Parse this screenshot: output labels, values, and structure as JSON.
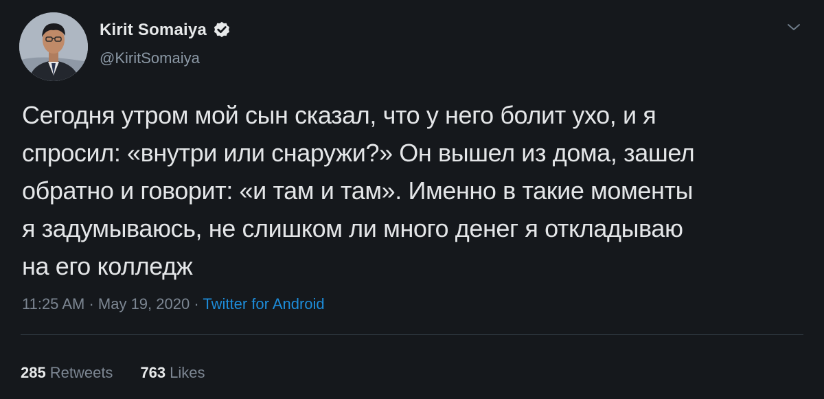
{
  "author": {
    "display_name": "Kirit Somaiya",
    "handle": "@KiritSomaiya",
    "verified": true,
    "avatar": "person-portrait"
  },
  "tweet": {
    "text_lines": [
      "Сегодня утром мой сын сказал, что у него болит ухо, и я",
      "спросил: «внутри или снаружи?» Он вышел из дома, зашел",
      "обратно и говорит: «и там и там». Именно в такие моменты",
      "я задумываюсь, не слишком ли много денег я откладываю",
      "на его колледж"
    ],
    "time": "11:25 AM",
    "date": "May 19, 2020",
    "source": "Twitter for Android",
    "separator": " · "
  },
  "stats": {
    "retweets_count": "285",
    "retweets_label": "Retweets",
    "likes_count": "763",
    "likes_label": "Likes"
  },
  "icons": {
    "verified": "verified-badge-icon",
    "menu": "chevron-down-icon"
  },
  "colors": {
    "background": "#15181c",
    "text": "#e4e6e8",
    "muted": "#7d8793",
    "link": "#1d8cd9",
    "divider": "#38444d"
  }
}
